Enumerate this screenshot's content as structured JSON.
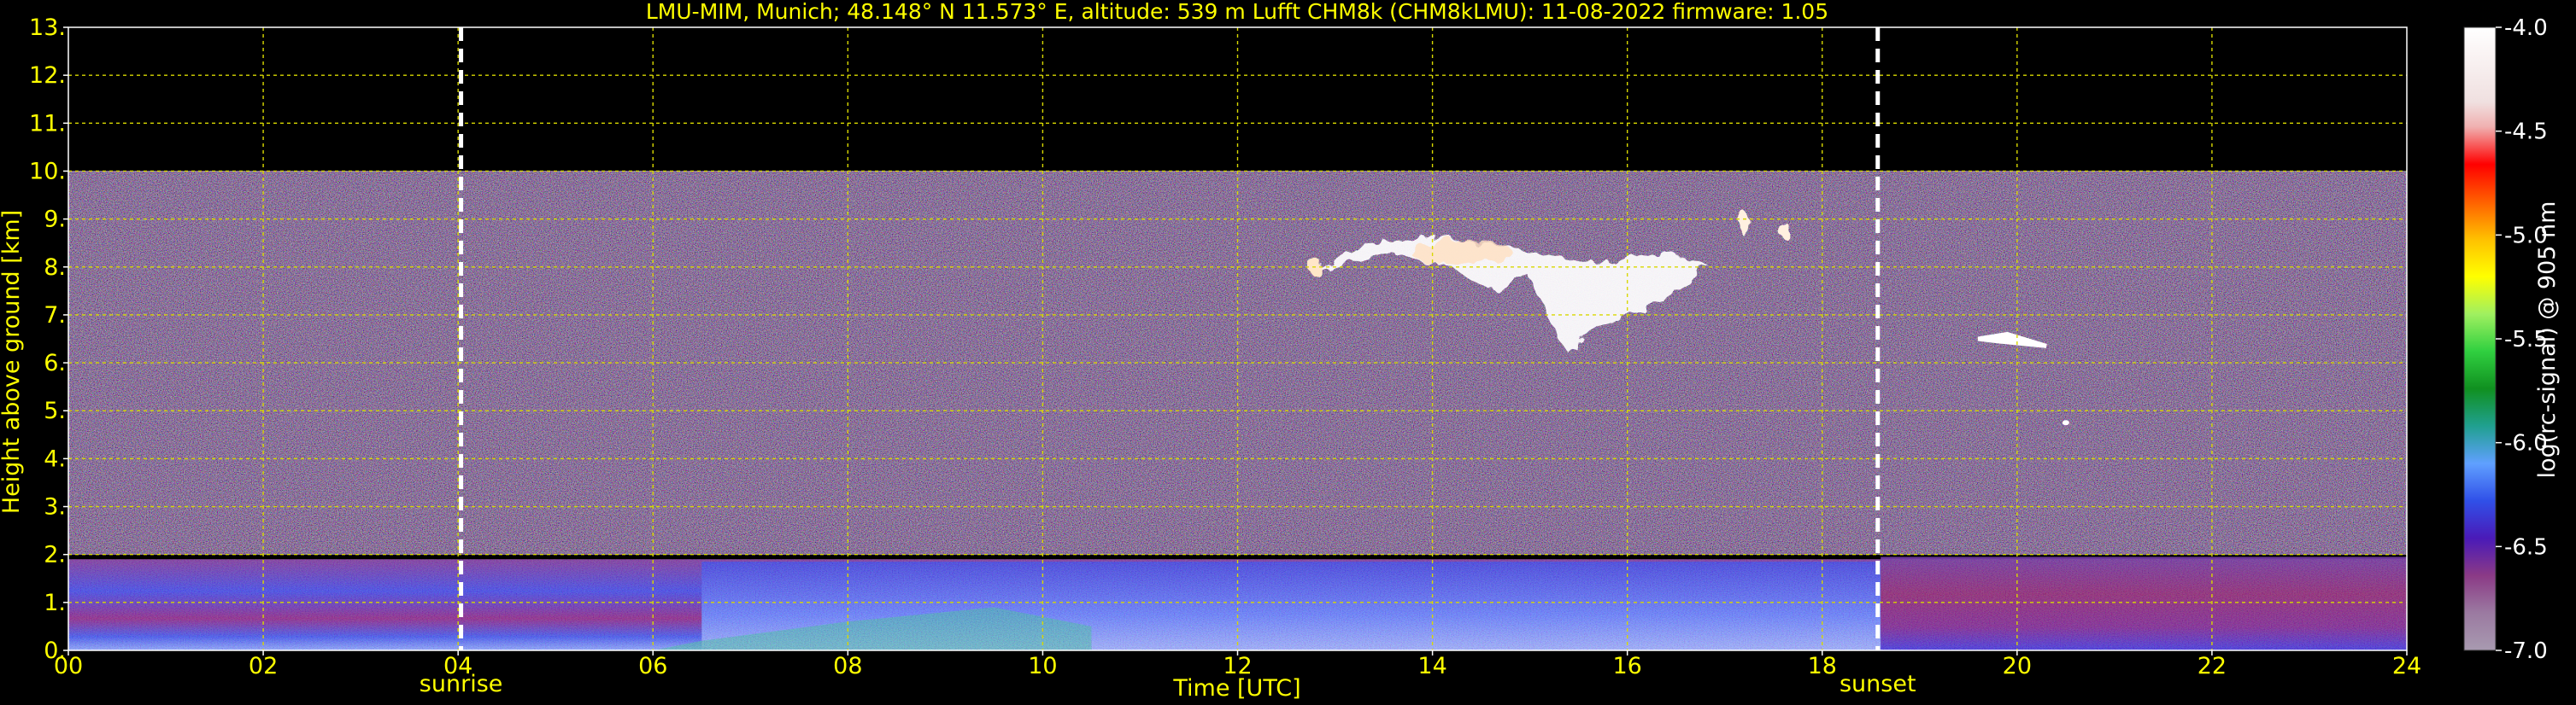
{
  "chart_data": {
    "type": "heatmap",
    "title": "LMU-MIM, Munich; 48.148° N 11.573° E, altitude: 539 m    Lufft CHM8k (CHM8kLMU): 11-08-2022    firmware: 1.05",
    "xlabel": "Time [UTC]",
    "ylabel": "Height above ground [km]",
    "xlim": [
      0,
      24
    ],
    "ylim": [
      0,
      13
    ],
    "x_ticks": [
      "00",
      "02",
      "04",
      "06",
      "08",
      "10",
      "12",
      "14",
      "16",
      "18",
      "20",
      "22",
      "24"
    ],
    "y_ticks": [
      "0.",
      "1.",
      "2.",
      "3.",
      "4.",
      "5.",
      "6.",
      "7.",
      "8.",
      "9.",
      "10.",
      "11.",
      "12.",
      "13."
    ],
    "grid": true,
    "grid_color": "#d8d800",
    "text_color": "#ffff00",
    "background": "#000000",
    "markers": [
      {
        "label": "sunrise",
        "time_utc": 4.03
      },
      {
        "label": "sunset",
        "time_utc": 18.57
      }
    ],
    "colorbar": {
      "label": "log(rc-signal) @ 905 nm",
      "range": [
        -7.0,
        -4.0
      ],
      "ticks": [
        "-4.0",
        "-4.5",
        "-5.0",
        "-5.5",
        "-6.0",
        "-6.5",
        "-7.0"
      ]
    },
    "features": [
      {
        "name": "noise_region",
        "time_range": [
          0,
          24
        ],
        "height_range": [
          2.0,
          10.0
        ]
      },
      {
        "name": "boundary_layer",
        "time_range": [
          0,
          24
        ],
        "height_range": [
          0,
          1.9
        ]
      },
      {
        "name": "cirrus_cloud",
        "time_range": [
          12.7,
          17.6
        ],
        "height_range": [
          6.2,
          8.9
        ]
      },
      {
        "name": "cloud_patch",
        "time_range": [
          19.6,
          20.3
        ],
        "height_range": [
          6.3,
          6.6
        ]
      }
    ]
  }
}
